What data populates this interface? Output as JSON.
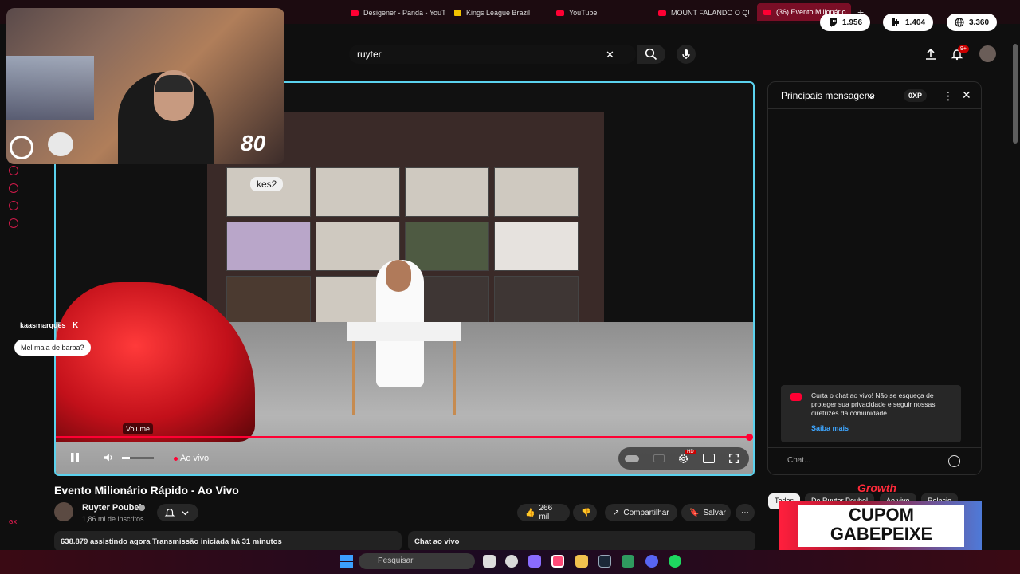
{
  "browser": {
    "tabs": [
      {
        "label": "Desigener - Panda - YouTu"
      },
      {
        "label": "Kings League Brazil"
      },
      {
        "label": "YouTube"
      },
      {
        "label": "MOUNT FALANDO O QUE"
      },
      {
        "label": "(36) Evento Milionário"
      }
    ]
  },
  "counters": {
    "twitch": "1.956",
    "kick": "1.404",
    "total": "3.360"
  },
  "webcam": {
    "count": "80"
  },
  "search": {
    "query": "ruyter"
  },
  "notifications": {
    "badge": "9+"
  },
  "player": {
    "volume_tooltip": "Volume",
    "live_label": "Ao vivo",
    "hd_badge": "HD",
    "overlay_user": "kaasmarques",
    "overlay_message": "Mel maia de barba?",
    "screen_label": "kes2"
  },
  "chat": {
    "title": "Principais mensagens",
    "xp": "0XP",
    "notice": "Curta o chat ao vivo! Não se esqueça de proteger sua privacidade e seguir nossas diretrizes da comunidade.",
    "learn_more": "Saiba mais",
    "placeholder": "Chat..."
  },
  "video": {
    "title": "Evento Milionário Rápido - Ao Vivo",
    "channel": "Ruyter Poubel",
    "subscribers": "1,86 mi de inscritos",
    "likes": "266 mil",
    "share": "Compartilhar",
    "save": "Salvar",
    "info": "638.879 assistindo agora  Transmissão iniciada há 31 minutos",
    "chat_live": "Chat ao vivo"
  },
  "chips": [
    "Todos",
    "De Ruyter Poubel",
    "Ao vivo",
    "Relacio"
  ],
  "promo": {
    "brand": "Growth",
    "line1": "CUPOM",
    "line2": "GABEPEIXE"
  },
  "side": {
    "gx": "GX"
  },
  "taskbar": {
    "search": "Pesquisar"
  },
  "colors": {
    "accent": "#ff0033",
    "player_border": "#5bd2ee",
    "link": "#3ea6ff"
  }
}
